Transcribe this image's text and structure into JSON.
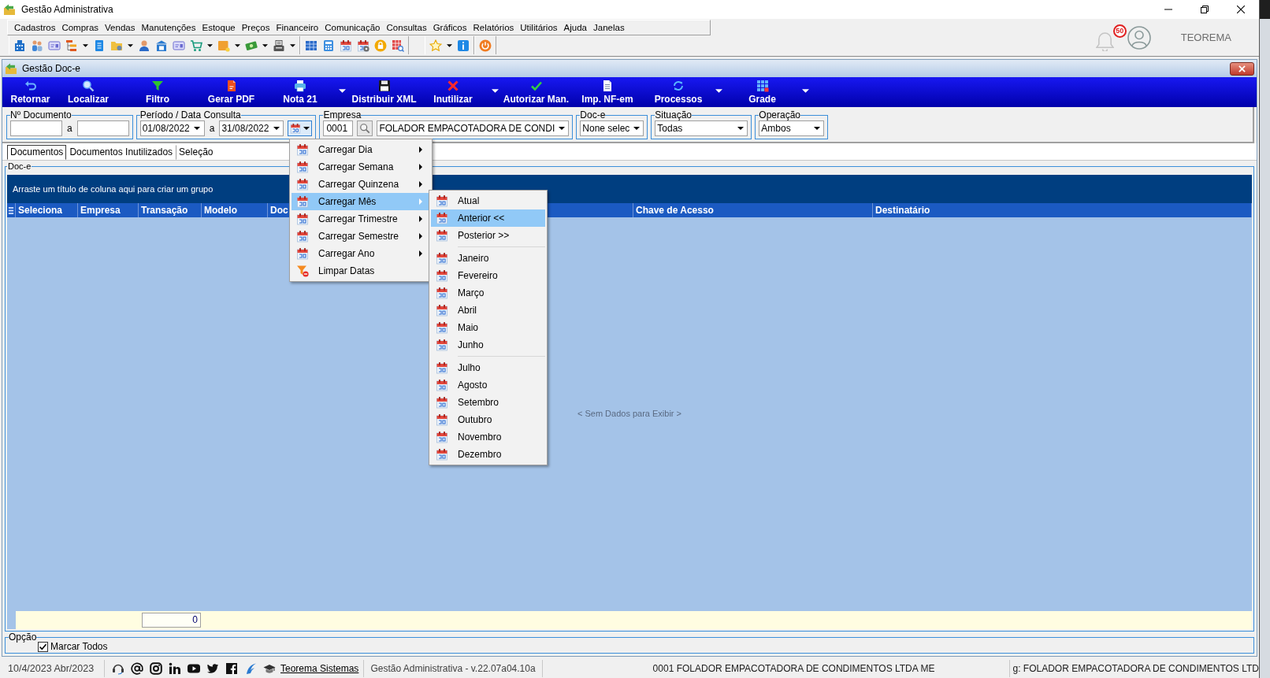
{
  "app": {
    "title": "Gestão Administrativa"
  },
  "menu_bar": [
    {
      "label": "Cadastros"
    },
    {
      "label": "Compras"
    },
    {
      "label": "Vendas"
    },
    {
      "label": "Manutenções"
    },
    {
      "label": "Estoque"
    },
    {
      "label": "Preços"
    },
    {
      "label": "Financeiro"
    },
    {
      "label": "Comunicação"
    },
    {
      "label": "Consultas"
    },
    {
      "label": "Gráficos"
    },
    {
      "label": "Relatórios"
    },
    {
      "label": "Utilitários"
    },
    {
      "label": "Ajuda"
    },
    {
      "label": "Janelas"
    }
  ],
  "header_right": {
    "notification_count": "50",
    "user": "TEOREMA"
  },
  "document_window": {
    "title": "Gestão Doc-e",
    "toolbar": [
      {
        "label": "Retornar",
        "dropdown": false
      },
      {
        "label": "Localizar",
        "dropdown": false
      },
      {
        "label": "Filtro",
        "dropdown": false
      },
      {
        "label": "Gerar PDF",
        "dropdown": false
      },
      {
        "label": "Nota 21",
        "dropdown": true
      },
      {
        "label": "Distribuir XML",
        "dropdown": false
      },
      {
        "label": "Inutilizar",
        "dropdown": true
      },
      {
        "label": "Autorizar Man.",
        "dropdown": false
      },
      {
        "label": "Imp. NF-em",
        "dropdown": false
      },
      {
        "label": "Processos",
        "dropdown": true
      },
      {
        "label": "Grade",
        "dropdown": true
      }
    ],
    "filters": {
      "document_number": {
        "label": "Nº Documento",
        "separator": "a"
      },
      "period": {
        "label": "Período / Data Consulta",
        "from": "01/08/2022",
        "separator": "a",
        "to": "31/08/2022"
      },
      "company": {
        "label": "Empresa",
        "code": "0001",
        "name": "FOLADOR EMPACOTADORA DE CONDI"
      },
      "document_type": {
        "label": "Doc-e",
        "value": "None selec"
      },
      "status": {
        "label": "Situação",
        "value": "Todas"
      },
      "operation": {
        "label": "Operação",
        "value": "Ambos"
      }
    },
    "period_menu": {
      "items": [
        {
          "label": "Carregar Dia",
          "kind": "submenu",
          "selected": false
        },
        {
          "label": "Carregar Semana",
          "kind": "submenu",
          "selected": false
        },
        {
          "label": "Carregar Quinzena",
          "kind": "submenu",
          "selected": false
        },
        {
          "label": "Carregar Mês",
          "kind": "submenu",
          "selected": true
        },
        {
          "label": "Carregar Trimestre",
          "kind": "submenu",
          "selected": false
        },
        {
          "label": "Carregar Semestre",
          "kind": "submenu",
          "selected": false
        },
        {
          "label": "Carregar Ano",
          "kind": "submenu",
          "selected": false
        },
        {
          "label": "Limpar Datas",
          "kind": "command",
          "selected": false
        }
      ]
    },
    "month_submenu": {
      "sections": [
        {
          "items": [
            {
              "label": "Atual",
              "selected": false
            },
            {
              "label": "Anterior <<",
              "selected": true
            },
            {
              "label": "Posterior >>",
              "selected": false
            }
          ]
        },
        {
          "items": [
            {
              "label": "Janeiro",
              "selected": false
            },
            {
              "label": "Fevereiro",
              "selected": false
            },
            {
              "label": "Março",
              "selected": false
            },
            {
              "label": "Abril",
              "selected": false
            },
            {
              "label": "Maio",
              "selected": false
            },
            {
              "label": "Junho",
              "selected": false
            }
          ]
        },
        {
          "items": [
            {
              "label": "Julho",
              "selected": false
            },
            {
              "label": "Agosto",
              "selected": false
            },
            {
              "label": "Setembro",
              "selected": false
            },
            {
              "label": "Outubro",
              "selected": false
            },
            {
              "label": "Novembro",
              "selected": false
            },
            {
              "label": "Dezembro",
              "selected": false
            }
          ]
        }
      ]
    },
    "tabs": [
      {
        "label": "Documentos",
        "selected": true
      },
      {
        "label": "Documentos Inutilizados",
        "selected": false
      },
      {
        "label": "Seleção",
        "selected": false
      }
    ],
    "grid": {
      "label": "Doc-e",
      "group_hint": "Arraste um título de coluna aqui para criar um grupo",
      "columns": [
        "Seleciona",
        "Empresa",
        "Transação",
        "Modelo",
        "Doc",
        "Chave de Acesso",
        "Destinatário"
      ],
      "empty_message": "< Sem Dados para Exibir >",
      "footer_total": "0"
    },
    "options": {
      "label": "Opção",
      "select_all": {
        "label": "Marcar Todos",
        "checked": true
      }
    }
  },
  "status_bar": {
    "date": "10/4/2023 Abr/2023",
    "link": "Teorema Sistemas",
    "version": "Gestão Administrativa - v.22.07a04.10a",
    "company": "0001 FOLADOR EMPACOTADORA DE CONDIMENTOS LTDA ME",
    "message": "g: FOLADOR EMPACOTADORA DE CONDIMENTOS LTD"
  }
}
